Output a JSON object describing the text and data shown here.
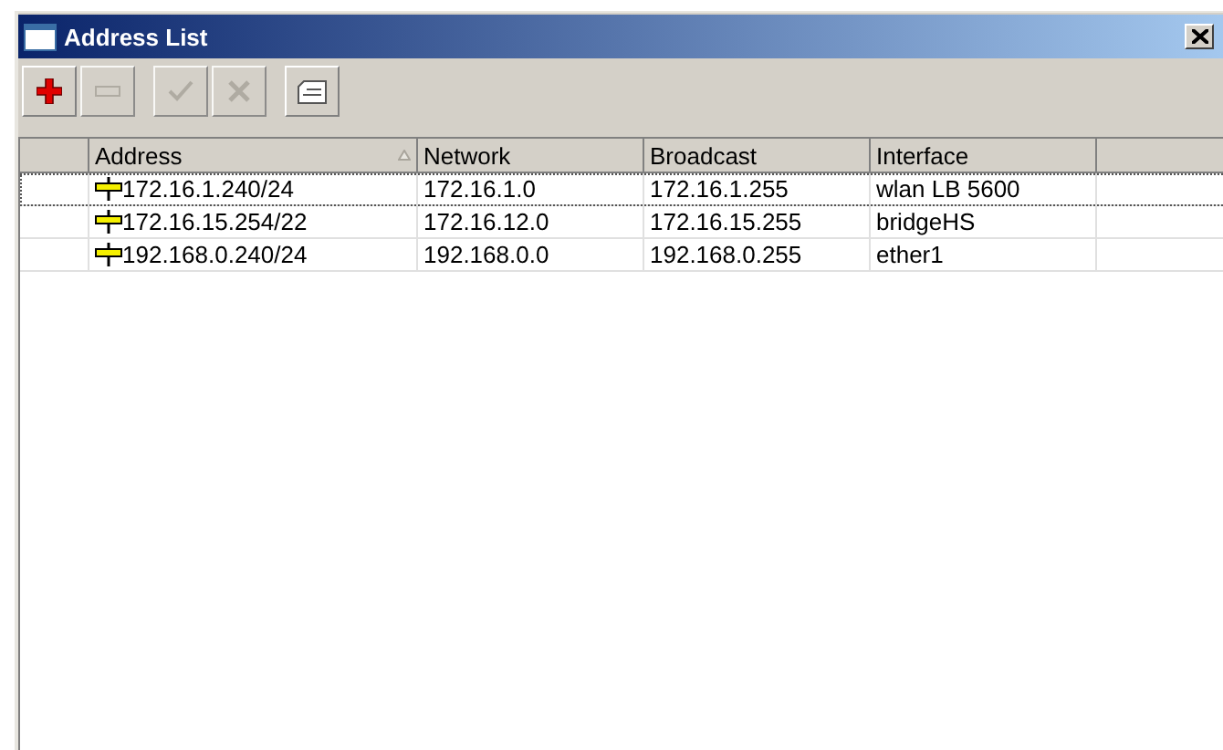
{
  "window": {
    "title": "Address List"
  },
  "toolbar": [
    {
      "kind": "add",
      "disabled": false
    },
    {
      "kind": "remove",
      "disabled": true
    },
    {
      "kind": "enable",
      "disabled": true
    },
    {
      "kind": "disable",
      "disabled": true
    },
    {
      "kind": "comment",
      "disabled": false
    }
  ],
  "table": {
    "columns": [
      {
        "label": "Address",
        "sorted": true
      },
      {
        "label": "Network",
        "sorted": false
      },
      {
        "label": "Broadcast",
        "sorted": false
      },
      {
        "label": "Interface",
        "sorted": false
      }
    ],
    "rows": [
      {
        "selected": true,
        "cells": [
          "172.16.1.240/24",
          "172.16.1.0",
          "172.16.1.255",
          "wlan LB 5600"
        ]
      },
      {
        "selected": false,
        "cells": [
          "172.16.15.254/22",
          "172.16.12.0",
          "172.16.15.255",
          "bridgeHS"
        ]
      },
      {
        "selected": false,
        "cells": [
          "192.168.0.240/24",
          "192.168.0.0",
          "192.168.0.255",
          "ether1"
        ]
      }
    ]
  }
}
